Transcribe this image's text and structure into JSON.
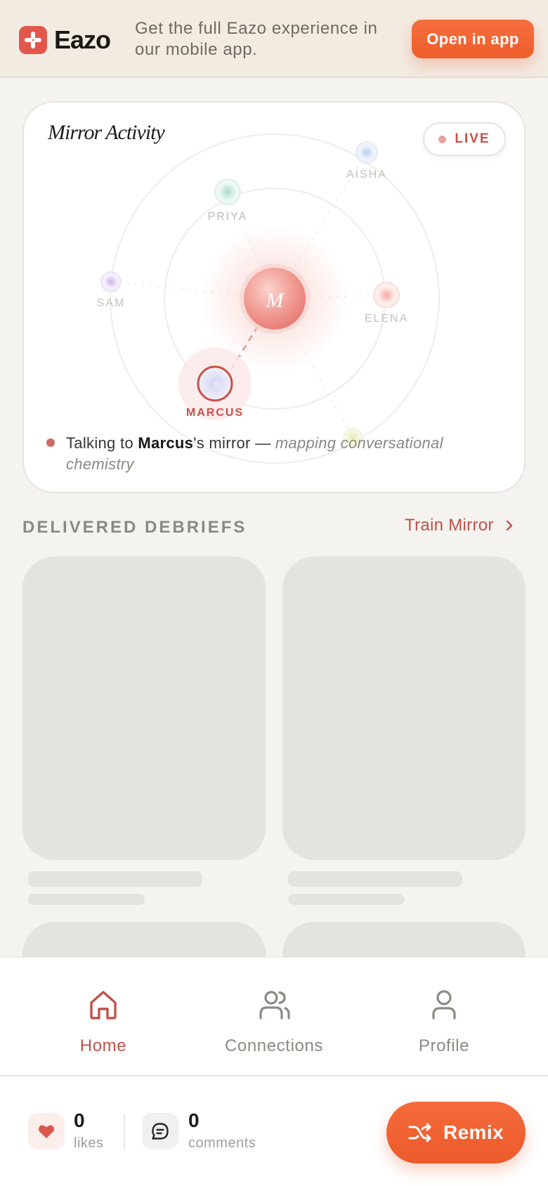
{
  "banner": {
    "brand_name": "Eazo",
    "message": "Get the full Eazo experience in our mobile app.",
    "open_button": "Open in app"
  },
  "mirror": {
    "title": "Mirror Activity",
    "live_label": "LIVE",
    "center_initial": "M",
    "nodes": [
      {
        "name": "AISHA",
        "color": "#8fb9e8"
      },
      {
        "name": "PRIYA",
        "color": "#8fd4bd"
      },
      {
        "name": "SAM",
        "color": "#c7a6e6"
      },
      {
        "name": "ELENA",
        "color": "#f29b95"
      },
      {
        "name": "MARCUS",
        "color": "#c9504a"
      }
    ],
    "status": {
      "prefix": "Talking to",
      "name": "Marcus",
      "middle": "'s mirror —",
      "activity": "mapping conversational chemistry"
    }
  },
  "debriefs": {
    "section_title": "DELIVERED DEBRIEFS",
    "train_link": "Train Mirror"
  },
  "nav": {
    "home": "Home",
    "connections": "Connections",
    "profile": "Profile",
    "active": "Home"
  },
  "actions": {
    "likes_count": "0",
    "likes_label": "likes",
    "comments_count": "0",
    "comments_label": "comments",
    "remix_label": "Remix"
  },
  "colors": {
    "accent": "#c0524c",
    "cta": "#f0622f",
    "background": "#f4f3ef"
  }
}
